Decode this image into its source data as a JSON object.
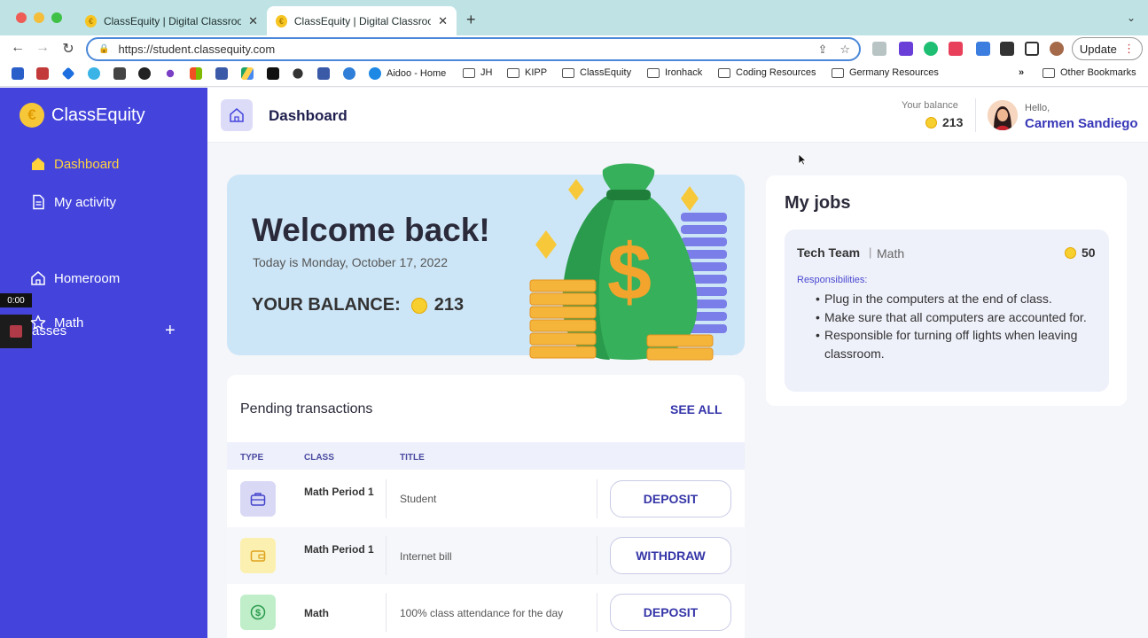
{
  "browser": {
    "tabs": [
      {
        "title": "ClassEquity | Digital Classroom",
        "active": false
      },
      {
        "title": "ClassEquity | Digital Classroom",
        "active": true
      }
    ],
    "url": "https://student.classequity.com",
    "update_label": "Update",
    "bookmarks": [
      {
        "label": "Aidoo - Home",
        "type": "site"
      },
      {
        "label": "JH",
        "type": "folder"
      },
      {
        "label": "KIPP",
        "type": "folder"
      },
      {
        "label": "ClassEquity",
        "type": "folder"
      },
      {
        "label": "Ironhack",
        "type": "folder"
      },
      {
        "label": "Coding Resources",
        "type": "folder"
      },
      {
        "label": "Germany Resources",
        "type": "folder"
      }
    ],
    "bookmarks_overflow": "»",
    "other_bookmarks": "Other Bookmarks"
  },
  "recording": {
    "time": "0:00"
  },
  "app": {
    "brand": "ClassEquity",
    "sidebar": {
      "items": [
        {
          "label": "Dashboard",
          "icon": "home-icon",
          "active": true
        },
        {
          "label": "My activity",
          "icon": "document-icon",
          "active": false
        }
      ],
      "classes_label": "asses",
      "classes_add": "+",
      "classes": [
        {
          "label": "Homeroom",
          "icon": "home-outline-icon"
        },
        {
          "label": "Math",
          "icon": "star-icon"
        }
      ]
    },
    "header": {
      "title": "Dashboard",
      "balance_label": "Your balance",
      "balance": "213",
      "hello": "Hello,",
      "user_name": "Carmen Sandiego"
    },
    "welcome": {
      "title": "Welcome back!",
      "date": "Today is Monday, October 17, 2022",
      "balance_label": "YOUR BALANCE:",
      "balance": "213"
    },
    "pending": {
      "title": "Pending transactions",
      "see_all": "SEE ALL",
      "columns": [
        "TYPE",
        "CLASS",
        "TITLE"
      ],
      "rows": [
        {
          "icon": "briefcase-icon",
          "class": "Math Period 1",
          "title": "Student",
          "action": "DEPOSIT"
        },
        {
          "icon": "wallet-icon",
          "class": "Math Period 1",
          "title": "Internet bill",
          "action": "WITHDRAW"
        },
        {
          "icon": "dollar-icon",
          "class": "Math",
          "title": "100% class attendance for the day",
          "action": "DEPOSIT"
        }
      ]
    },
    "jobs": {
      "title": "My jobs",
      "job": {
        "name": "Tech Team",
        "separator": "|",
        "class": "Math",
        "pay": "50",
        "responsibilities_label": "Responsibilities:",
        "responsibilities": [
          "Plug in the computers at the end of class.",
          "Make sure that all computers are accounted for.",
          "Responsible for turning off lights when leaving classroom."
        ]
      }
    }
  },
  "colors": {
    "sidebar": "#4444dd",
    "active_nav": "#ffd23e",
    "accent_text": "#3535a8",
    "welcome_bg": "#cde6f7",
    "coin": "#f7cf2f"
  }
}
